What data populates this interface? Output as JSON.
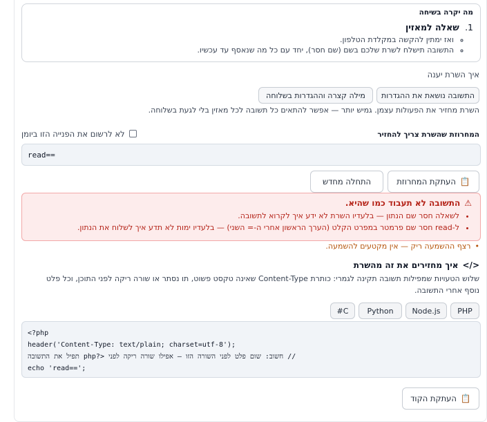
{
  "summary": {
    "title": "מה יקרה בשיחה",
    "question_number": "1.",
    "question_title": "שאלה למאזין",
    "bullets": [
      "ואז ימתין להקשה במקלדת הטלפון.",
      "התשובה תישלח לשרת שלכם בשם (שם חסר), יחד עם כל מה שנאסף עד עכשיו."
    ]
  },
  "response": {
    "label": "איך השרת יענה",
    "option_settings": "התשובה נושאת את ההגדרות",
    "option_short": "מילה קצרה וההגדרות בשלוחה",
    "description": "השרת מחזיר את הפעולות עצמן. גמיש יותר — אפשר להתאים כל תשובה לכל מאזין בלי לגעת בשלוחה."
  },
  "string_section": {
    "label": "המחרוזת שהשרת צריך להחזיר",
    "checkbox_label": "לא לרשום את הפנייה הזו ביומן",
    "value": "read=="
  },
  "actions": {
    "copy_string": "העתקת המחרוזת",
    "restart": "התחלה מחדש"
  },
  "alert": {
    "title": "התשובה לא תעבוד כמו שהיא.",
    "items": [
      "לשאלה חסר שם הנתון — בלעדיו השרת לא ידע איך לקרוא לתשובה.",
      "ל-read חסר שם פרמטר במפרט הקלט (הערך הראשון אחרי ה-= השני) — בלעדיו ימות לא תדע איך לשלוח את הנתון."
    ]
  },
  "warning": "רצף ההשמעה ריק — אין מקטעים להשמעה.",
  "code_section": {
    "title": "איך מחזירים את זה מהשרת",
    "description": "שלוש הטעויות שמפילות תשובה תקינה לגמרי: כותרת Content-Type שאינה טקסט פשוט, תו נסתר או שורה ריקה לפני התוכן, וכל פלט נוסף אחרי התשובה.",
    "tabs": [
      "PHP",
      "Node.js",
      "Python",
      "C#"
    ],
    "code_lines": [
      "<?php",
      "header('Content-Type: text/plain; charset=utf-8');",
      "// חשוב: שום פלט לפני השורה הזו — אפילו שורה ריקה לפני <?php תפיל את התשובה",
      "echo 'read==';"
    ],
    "copy_code": "העתקת הקוד"
  },
  "colors": {
    "alert_bg": "#fdecec",
    "alert_text": "#b42318",
    "warning_text": "#b45309"
  }
}
